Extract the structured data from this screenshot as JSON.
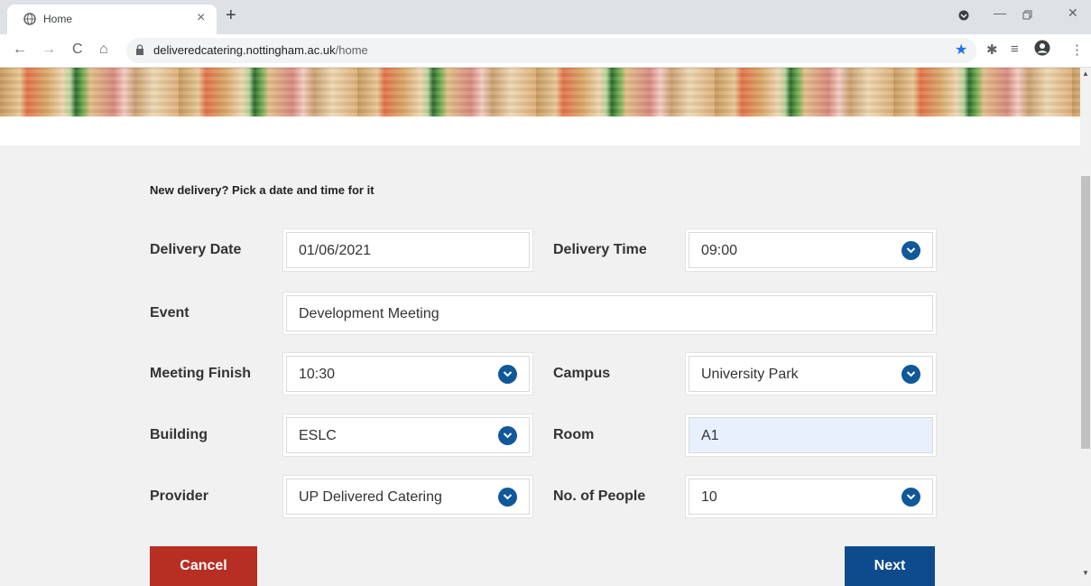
{
  "browser": {
    "tab_title": "Home",
    "tab_close": "×",
    "new_tab": "+",
    "url_domain": "deliveredcatering.nottingham.ac.uk",
    "url_path": "/home"
  },
  "form": {
    "heading": "New delivery? Pick a date and time for it",
    "delivery_date_label": "Delivery Date",
    "delivery_date_value": "01/06/2021",
    "delivery_time_label": "Delivery Time",
    "delivery_time_value": "09:00",
    "event_label": "Event",
    "event_value": "Development Meeting",
    "meeting_finish_label": "Meeting Finish",
    "meeting_finish_value": "10:30",
    "campus_label": "Campus",
    "campus_value": "University Park",
    "building_label": "Building",
    "building_value": "ESLC",
    "room_label": "Room",
    "room_value": "A1",
    "provider_label": "Provider",
    "provider_value": "UP Delivered Catering",
    "people_label": "No. of People",
    "people_value": "10"
  },
  "buttons": {
    "cancel": "Cancel",
    "next": "Next"
  },
  "colors": {
    "cancel": "#b72e22",
    "next": "#0d4b8c",
    "dropdown": "#10589a"
  }
}
